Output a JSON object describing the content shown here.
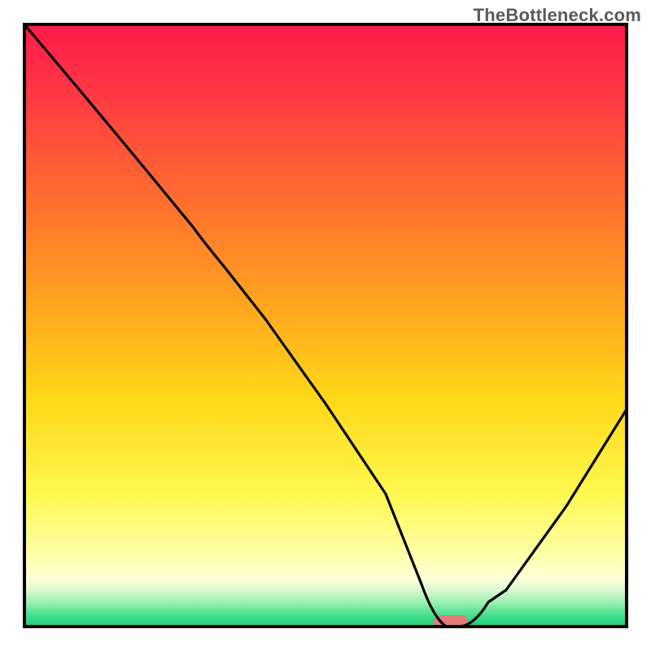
{
  "watermark": "TheBottleneck.com",
  "chart_data": {
    "type": "line",
    "title": "",
    "xlabel": "",
    "ylabel": "",
    "xlim": [
      0,
      100
    ],
    "ylim": [
      0,
      100
    ],
    "grid": false,
    "legend": false,
    "annotations": [],
    "series": [
      {
        "name": "bottleneck-curve",
        "x": [
          0,
          10,
          20,
          30,
          40,
          50,
          60,
          66,
          70,
          72,
          80,
          90,
          100
        ],
        "y": [
          100,
          88,
          76,
          65,
          51,
          37,
          22,
          7,
          0,
          0,
          6,
          20,
          36
        ]
      }
    ],
    "optimum_marker": {
      "x_start": 68,
      "x_end": 74,
      "y": 0,
      "color": "#e47a7a"
    },
    "bands": [
      {
        "color_top": "#ff1a4a",
        "color_bottom": "#ff4a3a",
        "y0": 100,
        "y1": 70
      },
      {
        "color_top": "#ff7a2a",
        "color_bottom": "#ffc21a",
        "y0": 70,
        "y1": 40
      },
      {
        "color_top": "#ffe61a",
        "color_bottom": "#ffff6a",
        "y0": 40,
        "y1": 12
      },
      {
        "color_top": "#ffffaa",
        "color_bottom": "#ffffda",
        "y0": 12,
        "y1": 6
      },
      {
        "color_top": "#c8f8c0",
        "color_bottom": "#6aeea0",
        "y0": 6,
        "y1": 2
      },
      {
        "color_top": "#30dd88",
        "color_bottom": "#18cc78",
        "y0": 2,
        "y1": 0
      }
    ]
  }
}
